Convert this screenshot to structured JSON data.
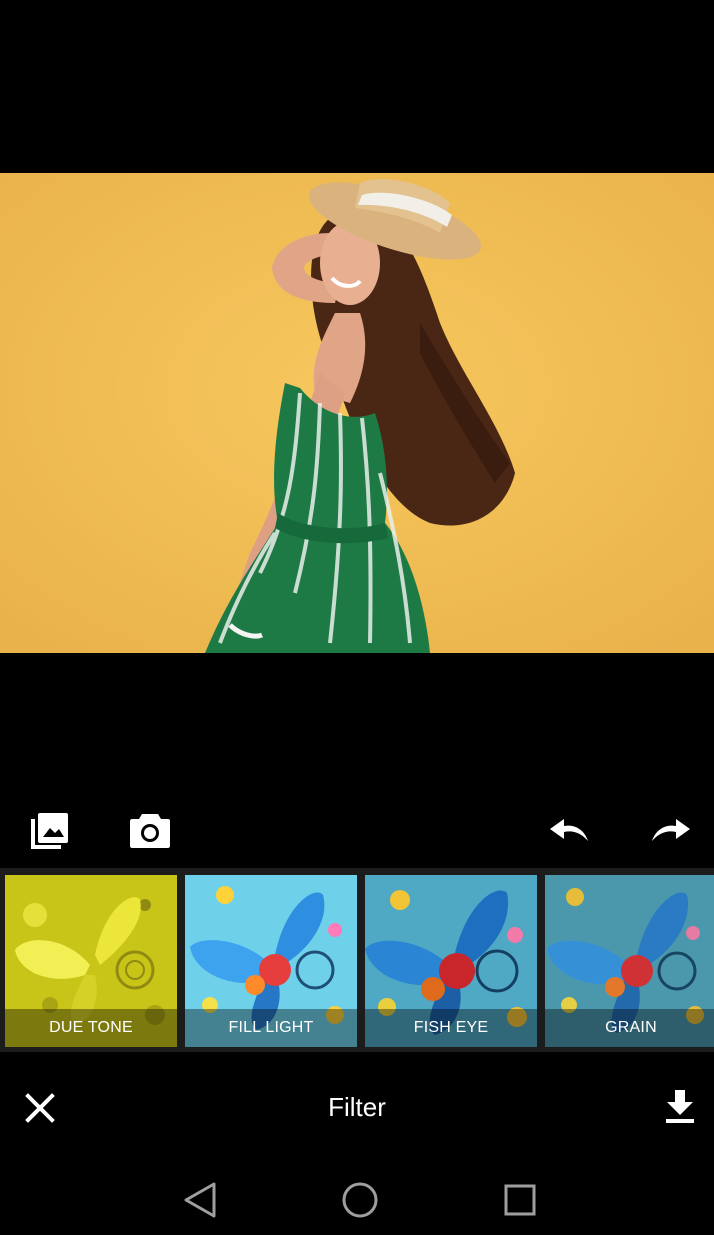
{
  "editor": {
    "title": "Filter"
  },
  "toolbar": {
    "gallery_icon": "gallery-icon",
    "camera_icon": "camera-icon",
    "undo_icon": "undo-icon",
    "redo_icon": "redo-icon"
  },
  "filters": [
    {
      "label": "DUE TONE"
    },
    {
      "label": "FILL LIGHT"
    },
    {
      "label": "FISH EYE"
    },
    {
      "label": "GRAIN"
    }
  ],
  "actions": {
    "close_icon": "close-icon",
    "download_icon": "download-icon"
  },
  "system_nav": {
    "back_icon": "back-triangle-icon",
    "home_icon": "home-circle-icon",
    "recents_icon": "recents-square-icon"
  },
  "colors": {
    "photo_background": "#f1bf55",
    "dress_green": "#1e7a45",
    "hair_brown": "#4a2614"
  }
}
